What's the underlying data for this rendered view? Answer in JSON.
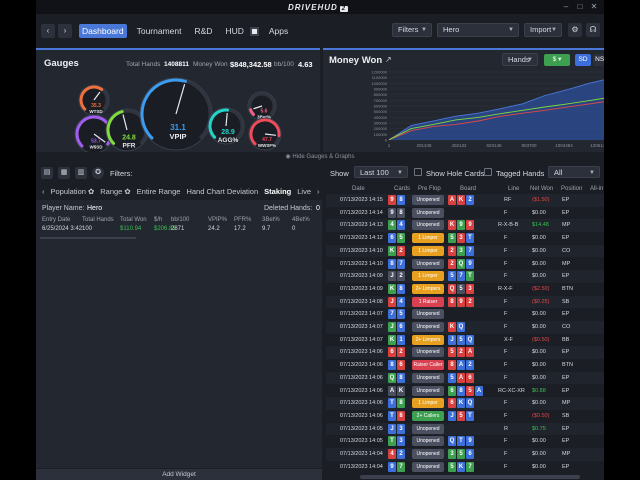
{
  "app": {
    "logo": "DRIVEHUD",
    "logo_badge": "2"
  },
  "nav": {
    "back": "‹",
    "forward": "›",
    "tabs": [
      "Dashboard",
      "Tournament",
      "R&D",
      "HUD",
      "Apps"
    ],
    "filters": "Filters",
    "player": "Hero",
    "import": "Import"
  },
  "gauges": {
    "title": "Gauges",
    "total_hands_label": "Total Hands",
    "total_hands": "1408811",
    "money_won_label": "Money Won",
    "money_won": "$848,342.58",
    "bb100_label": "bb/100",
    "bb100": "4.63",
    "items": [
      {
        "name": "WTSD",
        "value": "35.3",
        "color": "#f0703c"
      },
      {
        "name": "W$SD",
        "value": "53.7",
        "color": "#a35cf0"
      },
      {
        "name": "PFR",
        "value": "24.8",
        "color": "#7fdc3c"
      },
      {
        "name": "VPIP",
        "value": "31.1",
        "color": "#3c9cf0"
      },
      {
        "name": "AGG%",
        "value": "28.9",
        "color": "#22d4c8"
      },
      {
        "name": "3Bet%",
        "value": "5.6",
        "color": "#f0608a"
      },
      {
        "name": "WWSF%",
        "value": "47.7",
        "color": "#f04a5a"
      }
    ]
  },
  "money_won": {
    "title": "Money Won",
    "hands_select": "Hands",
    "currency": "$",
    "btns": [
      "SD",
      "NSD",
      "EV"
    ]
  },
  "chart_data": {
    "type": "area",
    "yticks": [
      "1200000",
      "1100000",
      "1000000",
      "900000",
      "800000",
      "700000",
      "600000",
      "500000",
      "400000",
      "300000",
      "200000",
      "100000",
      "0"
    ],
    "xticks": [
      "1",
      "201348",
      "402132",
      "603148",
      "803700",
      "1004484",
      "1205148",
      "1406082"
    ],
    "series": [
      {
        "color": "#4a78d9",
        "values": [
          0,
          250000,
          330000,
          420000,
          480000,
          560000,
          640000,
          780000,
          880000,
          1000000,
          1100000,
          1200000
        ]
      },
      {
        "color": "#e04848",
        "values": [
          0,
          160000,
          240000,
          280000,
          340000,
          420000,
          470000,
          520000,
          580000,
          640000,
          700000,
          760000
        ]
      },
      {
        "color": "#7fdc3c",
        "values": [
          0,
          200000,
          280000,
          360000,
          400000,
          460000,
          520000,
          580000,
          640000,
          700000,
          760000,
          840000
        ]
      }
    ]
  },
  "hide_bar": "Hide Gauges & Graphs",
  "filters_label": "Filters:",
  "stat_tabs": [
    "Population",
    "Range",
    "Entire Range",
    "Hand Chart Deviation",
    "Staking",
    "Live"
  ],
  "left_table": {
    "headers": [
      "Entry Date",
      "Total Hands",
      "Total Won",
      "$/h",
      "bb/100",
      "VPIP%",
      "PFR%",
      "3Bet%",
      "4Bet%"
    ],
    "row": [
      "6/25/2024 3:42:",
      "100",
      "$110.94",
      "$206.83",
      "2871",
      "24.2",
      "17.2",
      "9.7",
      "0"
    ],
    "player_name_label": "Player Name:",
    "player_name": "Hero",
    "deleted_hands_label": "Deleted Hands:",
    "deleted_hands": "0"
  },
  "add_widget": "Add Widget",
  "show_bar": {
    "show_label": "Show",
    "last": "Last 100",
    "show_hole": "Show Hole Cards",
    "tagged": "Tagged Hands",
    "all": "All"
  },
  "hands_table": {
    "headers": [
      "Date",
      "Cards",
      "Pre Flop",
      "Board",
      "Line",
      "Net Won",
      "Position",
      "All-in"
    ],
    "rows": [
      {
        "date": "07/13/2023 14:15",
        "cards": [
          "9",
          "8"
        ],
        "cc": [
          "#d94040",
          "#3c6fd9"
        ],
        "pf": "Unopened",
        "pfc": "#4a5060",
        "board": [
          "A",
          "K",
          "2"
        ],
        "bc": [
          "#d94040",
          "#d94040",
          "#3c6fd9"
        ],
        "line": "RF",
        "won": "($1.50)",
        "wc": "#e04848",
        "pos": "EP"
      },
      {
        "date": "07/13/2023 14:14",
        "cards": [
          "9",
          "8"
        ],
        "cc": [
          "#4a5060",
          "#4a5060"
        ],
        "pf": "Unopened",
        "pfc": "#4a5060",
        "board": [],
        "bc": [],
        "line": "F",
        "won": "$0.00",
        "wc": "#d5d9e1",
        "pos": "EP"
      },
      {
        "date": "07/13/2023 14:13",
        "cards": [
          "4",
          "4"
        ],
        "cc": [
          "#3ca050",
          "#3c6fd9"
        ],
        "pf": "Unopened",
        "pfc": "#4a5060",
        "board": [
          "K",
          "9",
          "9"
        ],
        "bc": [
          "#d94040",
          "#3ca050",
          "#d94040"
        ],
        "line": "R-X-B-B",
        "won": "$14.48",
        "wc": "#3cc050",
        "pos": "MP"
      },
      {
        "date": "07/13/2023 14:12",
        "cards": [
          "6",
          "5"
        ],
        "cc": [
          "#3c6fd9",
          "#3ca050"
        ],
        "pf": "1 Limper",
        "pfc": "#e8a020",
        "board": [
          "5",
          "3",
          "T"
        ],
        "bc": [
          "#3ca050",
          "#d94040",
          "#3c6fd9"
        ],
        "line": "F",
        "won": "$0.00",
        "wc": "#d5d9e1",
        "pos": "EP"
      },
      {
        "date": "07/13/2023 14:10",
        "cards": [
          "K",
          "2"
        ],
        "cc": [
          "#3ca050",
          "#d94040"
        ],
        "pf": "1 Limper",
        "pfc": "#e8a020",
        "board": [
          "2",
          "3",
          "7"
        ],
        "bc": [
          "#d94040",
          "#3ca050",
          "#3c6fd9"
        ],
        "line": "F",
        "won": "$0.00",
        "wc": "#d5d9e1",
        "pos": "CO"
      },
      {
        "date": "07/13/2023 14:10",
        "cards": [
          "8",
          "7"
        ],
        "cc": [
          "#3c6fd9",
          "#3c6fd9"
        ],
        "pf": "Unopened",
        "pfc": "#4a5060",
        "board": [
          "2",
          "Q",
          "9"
        ],
        "bc": [
          "#d94040",
          "#3ca050",
          "#3c6fd9"
        ],
        "line": "F",
        "won": "$0.00",
        "wc": "#d5d9e1",
        "pos": "MP"
      },
      {
        "date": "07/13/2023 14:09",
        "cards": [
          "J",
          "2"
        ],
        "cc": [
          "#4a5060",
          "#4a5060"
        ],
        "pf": "1 Limper",
        "pfc": "#e8a020",
        "board": [
          "5",
          "7",
          "T"
        ],
        "bc": [
          "#3c6fd9",
          "#3c6fd9",
          "#3ca050"
        ],
        "line": "F",
        "won": "$0.00",
        "wc": "#d5d9e1",
        "pos": "EP"
      },
      {
        "date": "07/13/2023 14:09",
        "cards": [
          "K",
          "8"
        ],
        "cc": [
          "#3ca050",
          "#3c6fd9"
        ],
        "pf": "2+ Limpers",
        "pfc": "#e8a020",
        "board": [
          "Q",
          "5",
          "3"
        ],
        "bc": [
          "#d94040",
          "#4a5060",
          "#d94040"
        ],
        "line": "R-X-F",
        "won": "($2.50)",
        "wc": "#e04848",
        "pos": "BTN"
      },
      {
        "date": "07/13/2023 14:08",
        "cards": [
          "J",
          "4"
        ],
        "cc": [
          "#d94040",
          "#3c6fd9"
        ],
        "pf": "1 Raiser",
        "pfc": "#d94050",
        "board": [
          "8",
          "9",
          "2"
        ],
        "bc": [
          "#d94040",
          "#d94040",
          "#d94040"
        ],
        "line": "F",
        "won": "($0.25)",
        "wc": "#e04848",
        "pos": "SB"
      },
      {
        "date": "07/13/2023 14:07",
        "cards": [
          "7",
          "5"
        ],
        "cc": [
          "#3c6fd9",
          "#3c6fd9"
        ],
        "pf": "Unopened",
        "pfc": "#4a5060",
        "board": [],
        "bc": [],
        "line": "F",
        "won": "$0.00",
        "wc": "#d5d9e1",
        "pos": "EP"
      },
      {
        "date": "07/13/2023 14:07",
        "cards": [
          "J",
          "6"
        ],
        "cc": [
          "#3ca050",
          "#3c6fd9"
        ],
        "pf": "Unopened",
        "pfc": "#4a5060",
        "board": [
          "K",
          "Q"
        ],
        "bc": [
          "#d94040",
          "#3c6fd9"
        ],
        "line": "F",
        "won": "$0.00",
        "wc": "#d5d9e1",
        "pos": "CO"
      },
      {
        "date": "07/13/2023 14:07",
        "cards": [
          "K",
          "1"
        ],
        "cc": [
          "#3ca050",
          "#3c6fd9"
        ],
        "pf": "2+ Limpers",
        "pfc": "#e8a020",
        "board": [
          "J",
          "5",
          "Q"
        ],
        "bc": [
          "#3c6fd9",
          "#3c6fd9",
          "#3c6fd9"
        ],
        "line": "X-F",
        "won": "($0.50)",
        "wc": "#e04848",
        "pos": "BB"
      },
      {
        "date": "07/13/2023 14:06",
        "cards": [
          "6",
          "2"
        ],
        "cc": [
          "#d94040",
          "#d94040"
        ],
        "pf": "Unopened",
        "pfc": "#4a5060",
        "board": [
          "5",
          "2",
          "A"
        ],
        "bc": [
          "#d94040",
          "#d94040",
          "#d94040"
        ],
        "line": "F",
        "won": "$0.00",
        "wc": "#d5d9e1",
        "pos": "EP"
      },
      {
        "date": "07/13/2023 14:06",
        "cards": [
          "8",
          "6"
        ],
        "cc": [
          "#3c6fd9",
          "#d94040"
        ],
        "pf": "Raiser Caller",
        "pfc": "#d94050",
        "board": [
          "8",
          "A",
          "2"
        ],
        "bc": [
          "#d94040",
          "#3c6fd9",
          "#3c6fd9"
        ],
        "line": "F",
        "won": "$0.00",
        "wc": "#d5d9e1",
        "pos": "BTN"
      },
      {
        "date": "07/13/2023 14:06",
        "cards": [
          "Q",
          "8"
        ],
        "cc": [
          "#3ca050",
          "#3c6fd9"
        ],
        "pf": "Unopened",
        "pfc": "#4a5060",
        "board": [
          "5",
          "A",
          "6"
        ],
        "bc": [
          "#3c6fd9",
          "#d94040",
          "#d94040"
        ],
        "line": "F",
        "won": "$0.00",
        "wc": "#d5d9e1",
        "pos": "EP"
      },
      {
        "date": "07/13/2023 14:06",
        "cards": [
          "A",
          "K"
        ],
        "cc": [
          "#4a5060",
          "#4a5060"
        ],
        "pf": "Unopened",
        "pfc": "#4a5060",
        "board": [
          "6",
          "8",
          "5",
          "A"
        ],
        "bc": [
          "#3ca050",
          "#3c6fd9",
          "#d94040",
          "#3c6fd9"
        ],
        "line": "RC-XC-XR",
        "won": "$0.88",
        "wc": "#3cc050",
        "pos": "EP"
      },
      {
        "date": "07/13/2023 14:06",
        "cards": [
          "T",
          "8"
        ],
        "cc": [
          "#3c6fd9",
          "#3ca050"
        ],
        "pf": "1 Limper",
        "pfc": "#e8a020",
        "board": [
          "6",
          "K",
          "Q"
        ],
        "bc": [
          "#d94040",
          "#3c6fd9",
          "#3c6fd9"
        ],
        "line": "F",
        "won": "$0.00",
        "wc": "#d5d9e1",
        "pos": "MP"
      },
      {
        "date": "07/13/2023 14:06",
        "cards": [
          "T",
          "8"
        ],
        "cc": [
          "#3c6fd9",
          "#d94040"
        ],
        "pf": "2+ Callers",
        "pfc": "#3ca050",
        "board": [
          "J",
          "5",
          "T"
        ],
        "bc": [
          "#3c6fd9",
          "#d94040",
          "#3c6fd9"
        ],
        "line": "F",
        "won": "($0.50)",
        "wc": "#e04848",
        "pos": "SB"
      },
      {
        "date": "07/13/2023 14:05",
        "cards": [
          "J",
          "3"
        ],
        "cc": [
          "#3c6fd9",
          "#3c6fd9"
        ],
        "pf": "Unopened",
        "pfc": "#4a5060",
        "board": [],
        "bc": [],
        "line": "R",
        "won": "$0.75",
        "wc": "#3cc050",
        "pos": "EP"
      },
      {
        "date": "07/13/2023 14:05",
        "cards": [
          "T",
          "3"
        ],
        "cc": [
          "#3ca050",
          "#3c6fd9"
        ],
        "pf": "Unopened",
        "pfc": "#4a5060",
        "board": [
          "Q",
          "T",
          "9"
        ],
        "bc": [
          "#3c6fd9",
          "#3c6fd9",
          "#3c6fd9"
        ],
        "line": "F",
        "won": "$0.00",
        "wc": "#d5d9e1",
        "pos": "EP"
      },
      {
        "date": "07/13/2023 14:04",
        "cards": [
          "4",
          "2"
        ],
        "cc": [
          "#d94040",
          "#3c6fd9"
        ],
        "pf": "Unopened",
        "pfc": "#4a5060",
        "board": [
          "3",
          "5",
          "6"
        ],
        "bc": [
          "#3ca050",
          "#3ca050",
          "#3c6fd9"
        ],
        "line": "F",
        "won": "$0.00",
        "wc": "#d5d9e1",
        "pos": "MP"
      },
      {
        "date": "07/13/2023 14:04",
        "cards": [
          "9",
          "7"
        ],
        "cc": [
          "#3c6fd9",
          "#3ca050"
        ],
        "pf": "Unopened",
        "pfc": "#4a5060",
        "board": [
          "5",
          "K",
          "7"
        ],
        "bc": [
          "#3ca050",
          "#3c6fd9",
          "#3ca050"
        ],
        "line": "F",
        "won": "$0.00",
        "wc": "#d5d9e1",
        "pos": "EP"
      }
    ]
  }
}
